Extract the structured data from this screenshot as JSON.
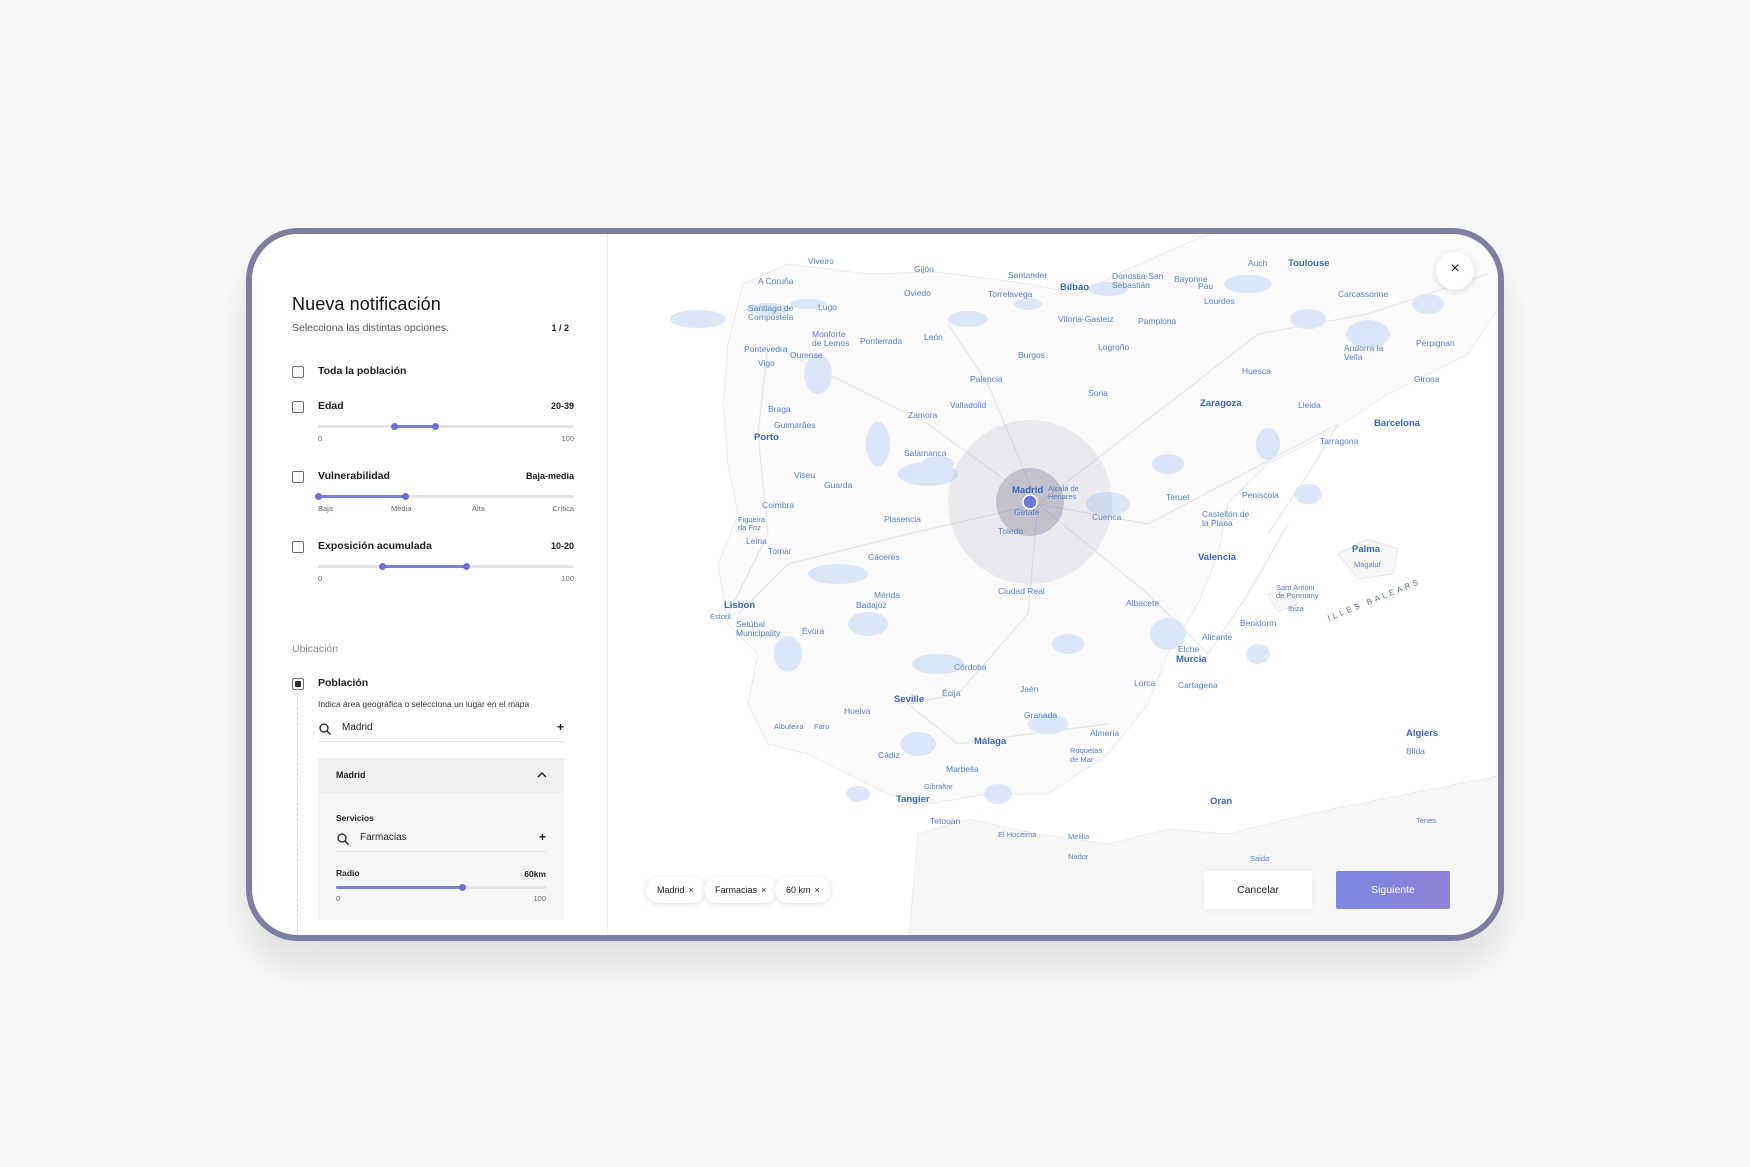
{
  "panel": {
    "title": "Nueva notificación",
    "subtitle": "Selecciona las distintas opciones.",
    "step": "1 / 2",
    "options": [
      {
        "label": "Toda la población",
        "checked": false
      },
      {
        "label": "Edad",
        "value": "20-39",
        "checked": false,
        "ticks": [
          "0",
          "100"
        ],
        "range": [
          0.3,
          0.46
        ]
      },
      {
        "label": "Vulnerabilidad",
        "value": "Baja-media",
        "checked": false,
        "ticks": [
          "Baja",
          "Media",
          "Alta",
          "Crítica"
        ],
        "range": [
          0.0,
          0.34
        ]
      },
      {
        "label": "Exposición acumulada",
        "value": "10-20",
        "checked": false,
        "ticks": [
          "0",
          "100"
        ],
        "range": [
          0.25,
          0.58
        ]
      }
    ],
    "location_section": "Ubicación",
    "poblacion": {
      "label": "Población",
      "checked": true,
      "hint": "Indica área geográfica o selecciona un lugar en el mapa",
      "search_value": "Madrid",
      "add_symbol": "+"
    },
    "accordion": {
      "title": "Madrid",
      "services_label": "Servicios",
      "services_value": "Farmacias",
      "radius_label": "Radio",
      "radius_value": "60km",
      "radius_ticks": [
        "0",
        "100"
      ],
      "radius_level": 0.6
    }
  },
  "map": {
    "close_symbol": "×",
    "chips": [
      {
        "label": "Madrid",
        "x": "×"
      },
      {
        "label": "Farmacias",
        "x": "×"
      },
      {
        "label": "60 km",
        "x": "×"
      }
    ],
    "cancel_label": "Cancelar",
    "next_label": "Siguiente",
    "place_labels": {
      "viveiro": "Viveiro",
      "gijon": "Gijón",
      "santander": "Santander",
      "bilbao": "Bilbao",
      "donostia": "Donostia-San Sebastián",
      "bayonne": "Bayonne",
      "auch": "Auch",
      "toulouse": "Toulouse",
      "acoruna": "A Coruña",
      "oviedo": "Oviedo",
      "torrelavega": "Torrelavega",
      "pau": "Pau",
      "lourdes": "Lourdes",
      "carcassonne": "Carcassonne",
      "santiago": "Santiago de Compostela",
      "lugo": "Lugo",
      "vitoria": "Vitoria-Gasteiz",
      "pamplona": "Pamplona",
      "pontevedra": "Pontevedra",
      "ourense": "Ourense",
      "monforte": "Monforte de Lemos",
      "ponferrada": "Ponferrada",
      "leon": "León",
      "burgos": "Burgos",
      "logrono": "Logroño",
      "andorra": "Andorra la Vella",
      "perpignan": "Perpignan",
      "vigo": "Vigo",
      "palencia": "Palencia",
      "huesca": "Huesca",
      "girona": "Girona",
      "braga": "Braga",
      "valladolid": "Valladolid",
      "soria": "Soria",
      "zaragoza": "Zaragoza",
      "lleida": "Lleida",
      "guimaraes": "Guimarães",
      "zamora": "Zamora",
      "porto": "Porto",
      "barcelona": "Barcelona",
      "tarragona": "Tarragona",
      "salamanca": "Salamanca",
      "viseu": "Viseu",
      "guarda": "Guarda",
      "madrid": "Madrid",
      "alcala": "Alcalá de Henares",
      "getafe": "Getafe",
      "teruel": "Teruel",
      "peniscola": "Peniscola",
      "coimbra": "Coimbra",
      "plasencia": "Plasencia",
      "cuenca": "Cuenca",
      "castellon": "Castellón de la Plana",
      "toledo": "Toledo",
      "figueira": "Figueira da Foz",
      "leiria": "Leiria",
      "tomar": "Tomar",
      "caceres": "Cáceres",
      "valencia": "Valencia",
      "palma": "Palma",
      "magaluf": "Magaluf",
      "lisbon": "Lisbon",
      "estoril": "Estoril",
      "merida": "Mérida",
      "ciudadreal": "Ciudad Real",
      "santantoni": "Sant Antoni de Portmany",
      "ibiza": "Ibiza",
      "setubal": "Setúbal Municipality",
      "badajoz": "Badajoz",
      "albacete": "Albacete",
      "illes": "ILLES BALEARS",
      "evora": "Évora",
      "benidorm": "Benidorm",
      "alicante": "Alicante",
      "elche": "Elche",
      "cordoba": "Córdoba",
      "murcia": "Murcia",
      "jaen": "Jaén",
      "lorca": "Lorca",
      "cartagena": "Cartagena",
      "ecija": "Écija",
      "seville": "Seville",
      "huelva": "Huelva",
      "albufeira": "Albufeira",
      "faro": "Faro",
      "granada": "Granada",
      "malaga": "Málaga",
      "almeria": "Almería",
      "cadiz": "Cádiz",
      "marbella": "Marbella",
      "roquetas": "Roquetas de Mar",
      "algiers": "Algiers",
      "blida": "Blida",
      "gibraltar": "Gibraltar",
      "tangier": "Tangier",
      "oran": "Oran",
      "tetouan": "Tetouan",
      "elhoceima": "El Hoceima",
      "melilla": "Melilla",
      "nador": "Nador",
      "saida": "Saida",
      "tenes": "Tenes"
    }
  }
}
